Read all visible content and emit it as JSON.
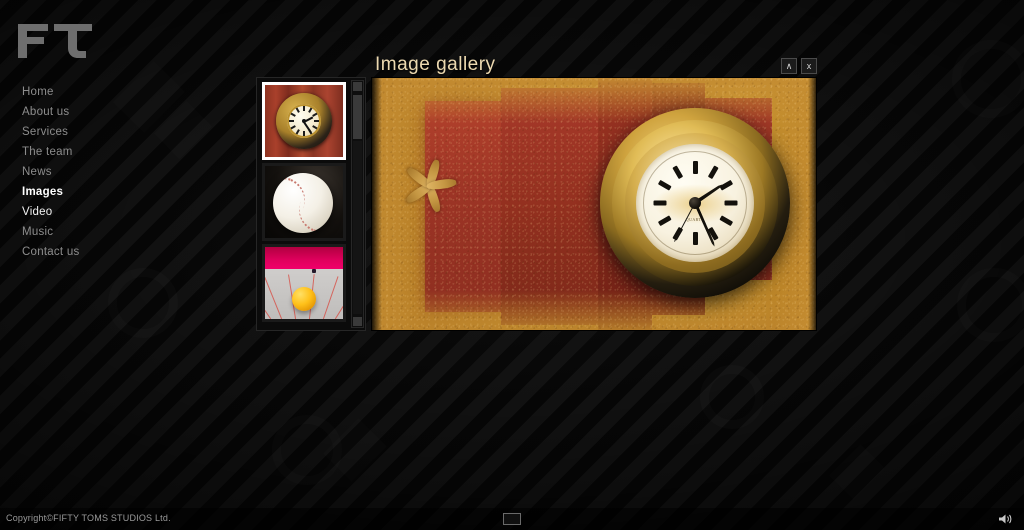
{
  "site": {
    "logo_text": "FT",
    "copyright": "Copyright©FIFTY TOMS STUDIOS Ltd."
  },
  "sidebar": {
    "items": [
      {
        "label": "Home",
        "state": "normal"
      },
      {
        "label": "About us",
        "state": "normal"
      },
      {
        "label": "Services",
        "state": "normal"
      },
      {
        "label": "The team",
        "state": "normal"
      },
      {
        "label": "News",
        "state": "normal"
      },
      {
        "label": "Images",
        "state": "active"
      },
      {
        "label": "Video",
        "state": "bright"
      },
      {
        "label": "Music",
        "state": "normal"
      },
      {
        "label": "Contact us",
        "state": "normal"
      }
    ]
  },
  "gallery": {
    "title": "Image gallery",
    "controls": {
      "collapse_label": "∧",
      "close_label": "x"
    },
    "thumbnails": [
      {
        "name": "clock-on-red-wood",
        "selected": true
      },
      {
        "name": "baseball",
        "selected": false
      },
      {
        "name": "yellow-ball-alley",
        "selected": false
      }
    ],
    "main_image": {
      "name": "clock-starfish-sand",
      "alt": "Brass clock with Roman numerals on red painted wood with sand and a starfish"
    },
    "scrollbar": {
      "up_label": "▲",
      "down_label": "▼"
    }
  },
  "bottom_bar": {
    "center_button_label": "",
    "volume_icon": "speaker-icon"
  },
  "colors": {
    "background": "#0d0d0d",
    "stripe_light": "#111111",
    "stripe_dark": "#060606",
    "title_text": "#ecd9b0",
    "nav_text": "#8d8d8d",
    "nav_active": "#ffffff",
    "selection_border": "#ffffff",
    "image_gold": "#cfa33e",
    "image_red_wood": "#9c3425",
    "image_sand": "#c08a2e"
  }
}
